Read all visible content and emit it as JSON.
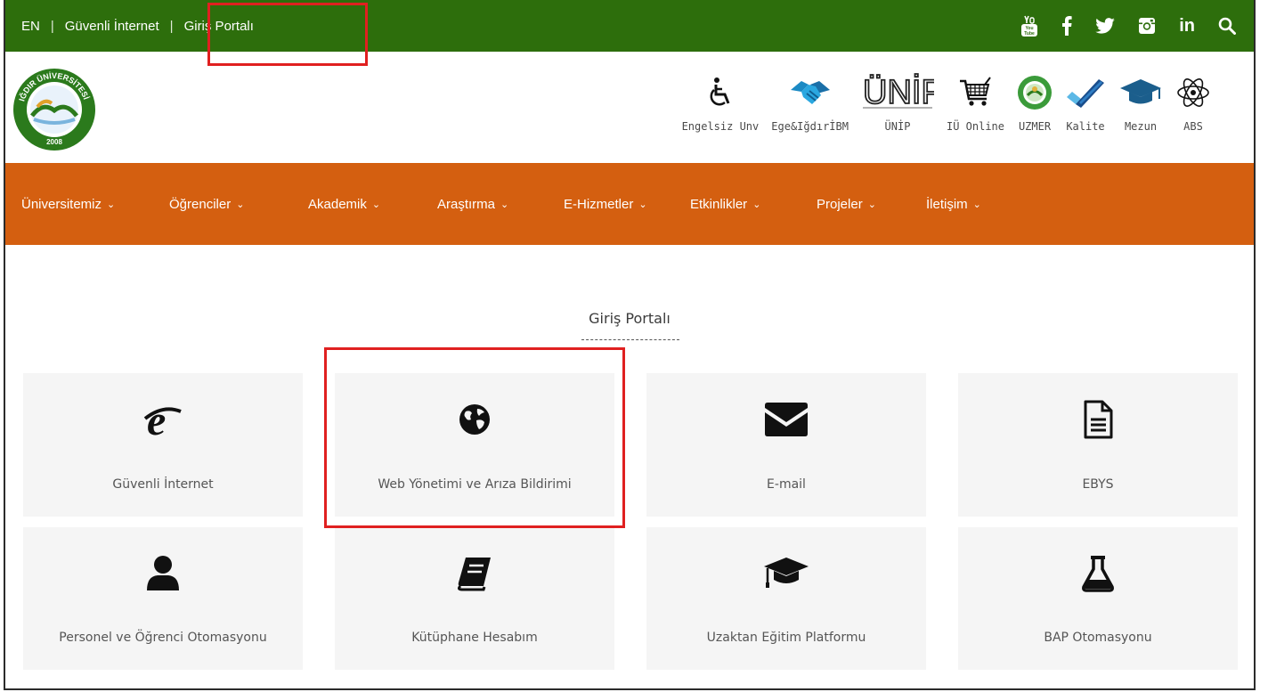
{
  "topbar": {
    "lang": "EN",
    "separator": "|",
    "link_internet": "Güvenli İnternet",
    "link_portal": "Giriş Portalı",
    "social_icons": [
      "youtube-icon",
      "facebook-icon",
      "twitter-icon",
      "instagram-icon",
      "linkedin-icon",
      "search-icon"
    ],
    "bg_color": "#2d6e0c"
  },
  "header": {
    "logo_year": "2008",
    "logo_text": "IĞDIR ÜNİVERSİTESİ",
    "shortcuts": [
      {
        "label": "Engelsiz Unv",
        "icon": "wheelchair-icon"
      },
      {
        "label": "Ege&IğdırİBM",
        "icon": "handshake-icon"
      },
      {
        "label": "ÜNİP",
        "icon": "unip-logo-icon"
      },
      {
        "label": "IÜ Online",
        "icon": "cart-icon"
      },
      {
        "label": "UZMER",
        "icon": "uzmer-logo-icon"
      },
      {
        "label": "Kalite",
        "icon": "check-icon"
      },
      {
        "label": "Mezun",
        "icon": "graduation-cap-icon"
      },
      {
        "label": "ABS",
        "icon": "atom-icon"
      }
    ]
  },
  "nav": {
    "bg_color": "#d45f10",
    "items": [
      "Üniversitemiz",
      "Öğrenciler",
      "Akademik",
      "Araştırma",
      "E-Hizmetler",
      "Etkinlikler",
      "Projeler",
      "İletişim"
    ]
  },
  "main": {
    "title": "Giriş Portalı",
    "cards": [
      {
        "label": "Güvenli İnternet",
        "icon": "internet-explorer-icon"
      },
      {
        "label": "Web Yönetimi ve Arıza Bildirimi",
        "icon": "globe-icon"
      },
      {
        "label": "E-mail",
        "icon": "envelope-icon"
      },
      {
        "label": "EBYS",
        "icon": "document-icon"
      },
      {
        "label": "Personel ve Öğrenci Otomasyonu",
        "icon": "user-icon"
      },
      {
        "label": "Kütüphane Hesabım",
        "icon": "book-icon"
      },
      {
        "label": "Uzaktan Eğitim Platformu",
        "icon": "graduation-cap-icon"
      },
      {
        "label": "BAP Otomasyonu",
        "icon": "flask-icon"
      }
    ]
  },
  "highlight_color": "#e02020"
}
